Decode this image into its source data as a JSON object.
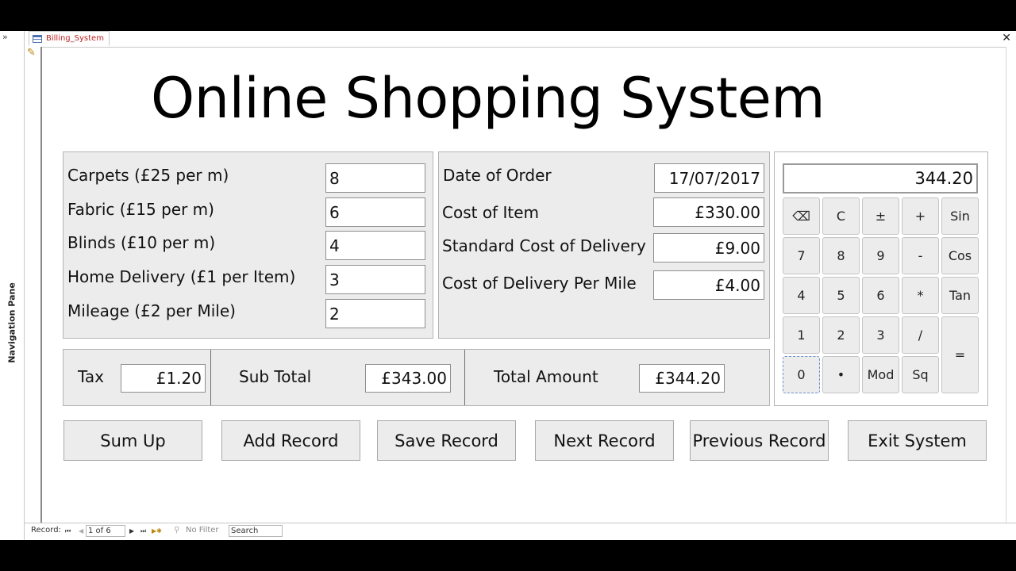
{
  "navigation": {
    "toggle_icon": "»",
    "label": "Navigation Pane"
  },
  "tab": {
    "title": "Billing_System",
    "close": "✕"
  },
  "title": "Online Shopping System",
  "items": [
    {
      "label": "Carpets (£25 per m)",
      "value": "8"
    },
    {
      "label": "Fabric (£15 per m)",
      "value": "6"
    },
    {
      "label": "Blinds (£10 per m)",
      "value": "4"
    },
    {
      "label": "Home Delivery (£1 per Item)",
      "value": "3"
    },
    {
      "label": "Mileage (£2 per Mile)",
      "value": "2"
    }
  ],
  "order": {
    "date_label": "Date of Order",
    "date_value": "17/07/2017",
    "cost_item_label": "Cost of Item",
    "cost_item_value": "£330.00",
    "std_delivery_label": "Standard Cost of Delivery",
    "std_delivery_value": "£9.00",
    "per_mile_label": "Cost of Delivery Per Mile",
    "per_mile_value": "£4.00"
  },
  "totals": {
    "tax_label": "Tax",
    "tax_value": "£1.20",
    "subtotal_label": "Sub Total",
    "subtotal_value": "£343.00",
    "total_label": "Total Amount",
    "total_value": "£344.20"
  },
  "calculator": {
    "display": "344.20",
    "buttons": [
      "⌫",
      "C",
      "±",
      "+",
      "Sin",
      "7",
      "8",
      "9",
      "-",
      "Cos",
      "4",
      "5",
      "6",
      "*",
      "Tan",
      "1",
      "2",
      "3",
      "/",
      "=",
      "0",
      "•",
      "Mod",
      "Sq"
    ]
  },
  "actions": [
    "Sum Up",
    "Add Record",
    "Save Record",
    "Next Record",
    "Previous Record",
    "Exit System"
  ],
  "status_bar": {
    "record_label": "Record:",
    "first": "⏮",
    "prev": "◀",
    "position": "1 of 6",
    "next": "▶",
    "last": "⏭",
    "new": "▶✱",
    "filter": "No Filter",
    "search": "Search"
  }
}
